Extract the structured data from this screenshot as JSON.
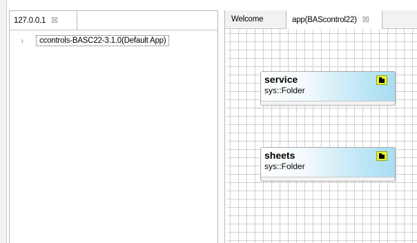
{
  "left_panel": {
    "tab": {
      "label": "127.0.0.1",
      "close": "☒"
    },
    "tree": [
      {
        "chevron": "›",
        "label": "ccontrols-BASC22-3.1.0(Default App)"
      }
    ]
  },
  "right_panel": {
    "tabs": [
      {
        "label": "Welcome"
      },
      {
        "label": "app(BAScontrol22)",
        "close": "☒"
      }
    ],
    "nodes": [
      {
        "title": "service",
        "type": "sys::Folder",
        "icon": "folder-icon"
      },
      {
        "title": "sheets",
        "type": "sys::Folder",
        "icon": "folder-icon"
      }
    ]
  },
  "colors": {
    "node_gradient_end": "#a8ddf3",
    "icon_bg": "#e9f230",
    "grid": "#cfcfcf"
  }
}
